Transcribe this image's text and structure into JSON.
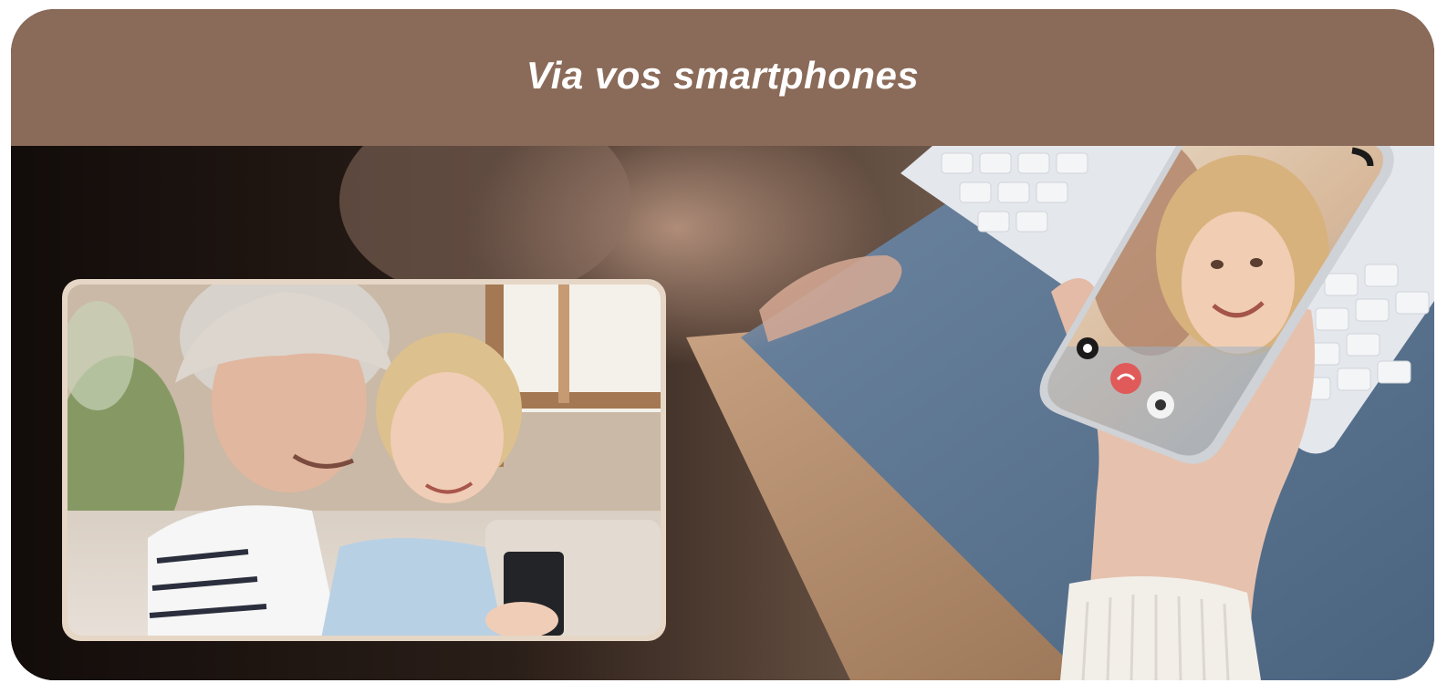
{
  "header": {
    "title": "Via vos smartphones"
  },
  "colors": {
    "header_bg": "#8a6a58",
    "card_dark": "#1a1411",
    "desk_wood": "#b89070",
    "desk_mat": "#55708a",
    "keyboard": "#e6e8ec",
    "photo_frame": "#e6d6c6",
    "hangup_red": "#e05a5a"
  },
  "images": {
    "background_photo": "person-holding-smartphone-video-call-photo",
    "inset_photo": "grandmother-and-child-on-sofa-photo",
    "phone_screen": "smiling-child-video-call-screen"
  }
}
